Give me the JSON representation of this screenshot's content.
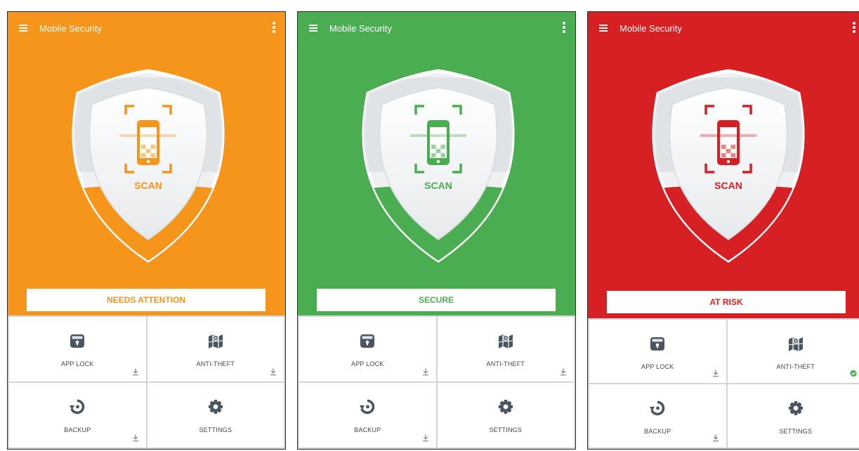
{
  "app_title": "Mobile Security",
  "scan_label": "SCAN",
  "screens": [
    {
      "state": "needs-attention",
      "accent_color": "#f5951c",
      "status_text": "NEEDS ATTENTION",
      "tiles": [
        {
          "label": "APP LOCK",
          "icon": "app-lock-icon",
          "badge": "download-icon"
        },
        {
          "label": "ANTI-THEFT",
          "icon": "anti-theft-map-icon",
          "badge": "download-icon"
        },
        {
          "label": "BACKUP",
          "icon": "backup-icon",
          "badge": "download-icon"
        },
        {
          "label": "SETTINGS",
          "icon": "settings-gear-icon",
          "badge": ""
        }
      ]
    },
    {
      "state": "secure",
      "accent_color": "#4aad52",
      "status_text": "SECURE",
      "tiles": [
        {
          "label": "APP LOCK",
          "icon": "app-lock-icon",
          "badge": "download-icon"
        },
        {
          "label": "ANTI-THEFT",
          "icon": "anti-theft-map-icon",
          "badge": "download-icon"
        },
        {
          "label": "BACKUP",
          "icon": "backup-icon",
          "badge": "download-icon"
        },
        {
          "label": "SETTINGS",
          "icon": "settings-gear-icon",
          "badge": ""
        }
      ]
    },
    {
      "state": "at-risk",
      "accent_color": "#d62024",
      "status_text": "AT RISK",
      "tiles": [
        {
          "label": "APP LOCK",
          "icon": "app-lock-icon",
          "badge": "download-icon"
        },
        {
          "label": "ANTI-THEFT",
          "icon": "anti-theft-map-icon",
          "badge": "check-circle-icon"
        },
        {
          "label": "BACKUP",
          "icon": "backup-icon",
          "badge": "download-icon"
        },
        {
          "label": "SETTINGS",
          "icon": "settings-gear-icon",
          "badge": ""
        }
      ]
    }
  ]
}
